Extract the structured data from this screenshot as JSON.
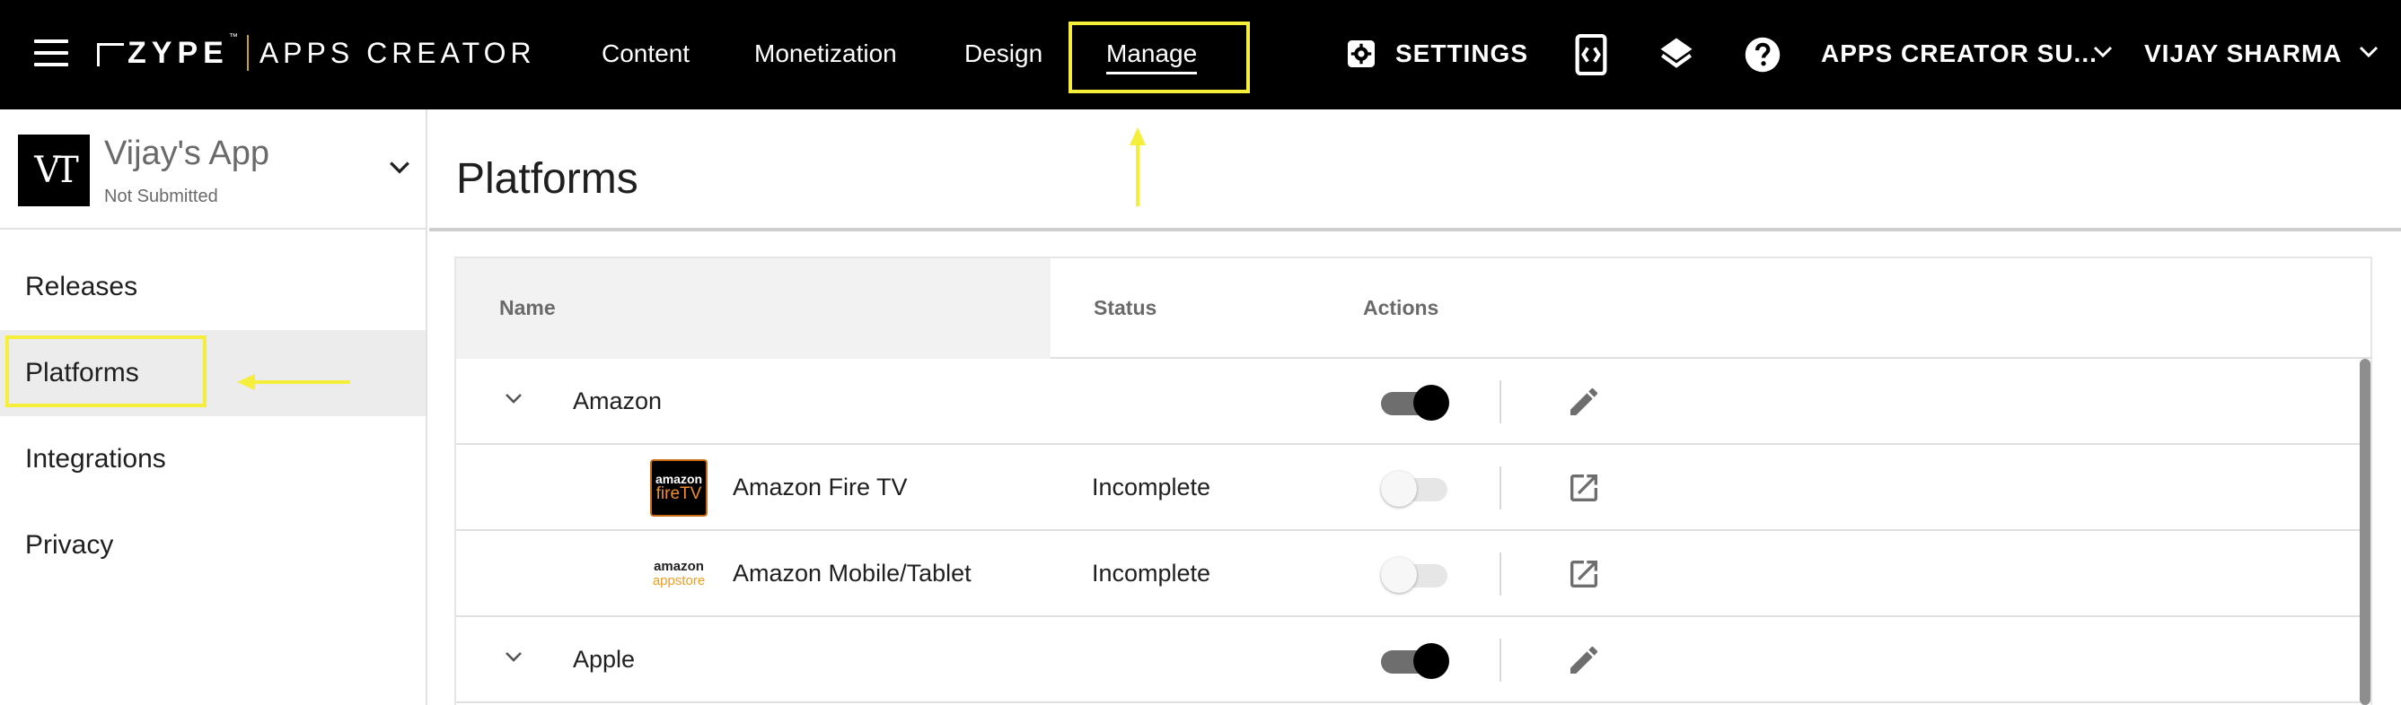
{
  "topbar": {
    "brand": "ZYPE",
    "brand_tm": "™",
    "product": "APPS CREATOR",
    "nav": [
      "Content",
      "Monetization",
      "Design",
      "Manage"
    ],
    "settings_label": "SETTINGS",
    "account_label": "APPS CREATOR SU...",
    "user_label": "VIJAY SHARMA",
    "highlight_color": "#f5ee3b",
    "icons": [
      "hamburger-icon",
      "gear-icon",
      "preview-device-icon",
      "layers-icon",
      "help-icon",
      "chevron-down-icon"
    ]
  },
  "app": {
    "logo_text": "VT",
    "name": "Vijay's App",
    "status": "Not Submitted"
  },
  "sidebar": {
    "items": [
      "Releases",
      "Platforms",
      "Integrations",
      "Privacy"
    ],
    "active_index": 1
  },
  "main": {
    "title": "Platforms",
    "columns": [
      "Name",
      "Status",
      "Actions"
    ],
    "rows": [
      {
        "type": "group",
        "name": "Amazon",
        "status": "",
        "enabled": true,
        "action_icon": "pencil-icon"
      },
      {
        "type": "item",
        "name": "Amazon Fire TV",
        "thumb": [
          "amazon",
          "fireTV"
        ],
        "status": "Incomplete",
        "enabled": false,
        "action_icon": "open-external-icon"
      },
      {
        "type": "item",
        "name": "Amazon Mobile/Tablet",
        "thumb": [
          "amazon",
          "appstore"
        ],
        "status": "Incomplete",
        "enabled": false,
        "action_icon": "open-external-icon"
      },
      {
        "type": "group",
        "name": "Apple",
        "status": "",
        "enabled": true,
        "action_icon": "pencil-icon"
      }
    ]
  }
}
